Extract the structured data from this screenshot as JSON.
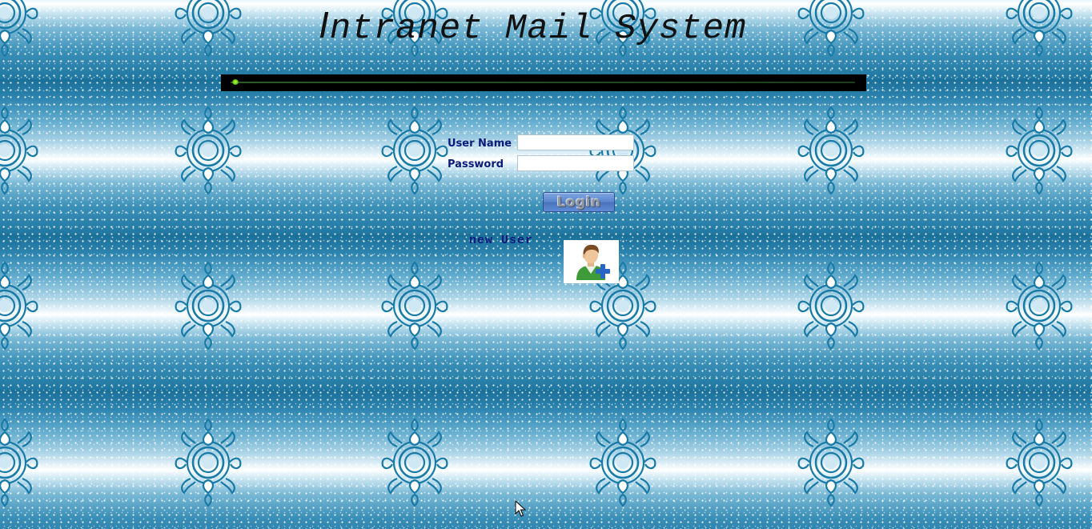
{
  "page": {
    "title_first_letter": "I",
    "title_rest": "ntranet Mail System",
    "background_color": "#2e86b0"
  },
  "login": {
    "username_label": "User Name",
    "username_value": "",
    "password_label": "Password",
    "password_value": "",
    "login_button_label": "Login"
  },
  "new_user": {
    "label": "new User",
    "icon": "add-user-icon"
  },
  "colors": {
    "label_text": "#0c1a7a",
    "marquee_bar": "#000000",
    "marquee_dot": "#8be028"
  }
}
